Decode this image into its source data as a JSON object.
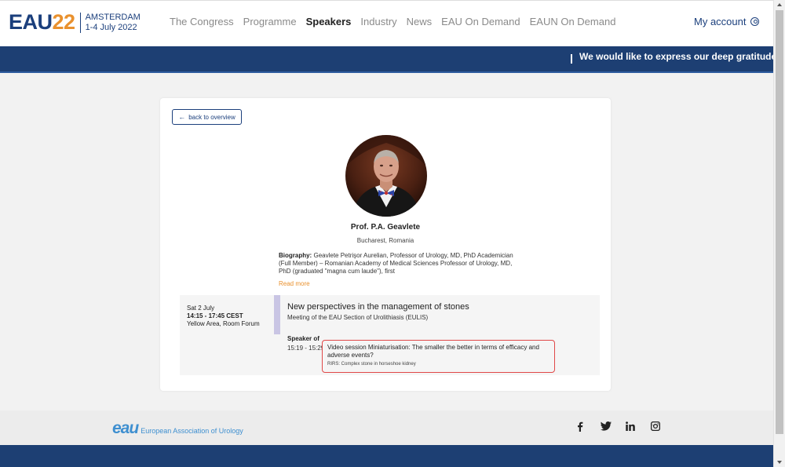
{
  "header": {
    "logo": {
      "eau": "EAU",
      "year": "22",
      "city": "AMSTERDAM",
      "dates": "1-4 July 2022"
    },
    "nav": [
      {
        "label": "The Congress",
        "active": false
      },
      {
        "label": "Programme",
        "active": false
      },
      {
        "label": "Speakers",
        "active": true
      },
      {
        "label": "Industry",
        "active": false
      },
      {
        "label": "News",
        "active": false
      },
      {
        "label": "EAU On Demand",
        "active": false
      },
      {
        "label": "EAUN On Demand",
        "active": false
      }
    ],
    "account_label": "My account"
  },
  "ticker": {
    "message": "We would like to express our deep gratitude to o"
  },
  "speaker": {
    "back_label": "back to overview",
    "name": "Prof. P.A. Geavlete",
    "location": "Bucharest, Romania",
    "bio_label": "Biography:",
    "bio_text": "Geavlete Petrişor Aurelian, Professor of Urology, MD, PhD Academician (Full Member) – Romanian Academy of Medical Sciences Professor of Urology, MD, PhD (graduated \"magna cum laude\"), first",
    "read_more": "Read more"
  },
  "session": {
    "day": "Sat 2 July",
    "time": "14:15 - 17:45 CEST",
    "room": "Yellow Area, Room Forum",
    "title": "New perspectives in the management of stones",
    "subtitle": "Meeting of the EAU Section of Urolithiasis (EULIS)",
    "speaker_of_label": "Speaker of",
    "talk_time": "15:19 - 15:29",
    "talk_title": "Video session Miniaturisation: The smaller the better in terms of efficacy and adverse events?",
    "talk_subtitle": "RIRS: Complex stone in horseshoe kidney"
  },
  "footer": {
    "logo_mark": "eau",
    "logo_text": "European Association of Urology",
    "socials": [
      "facebook-icon",
      "twitter-icon",
      "linkedin-icon",
      "instagram-icon"
    ]
  },
  "colors": {
    "brand_blue": "#1b3f7c",
    "accent_orange": "#e9912e",
    "highlight_red": "#e04848",
    "session_bar": "#c9c5e4"
  }
}
